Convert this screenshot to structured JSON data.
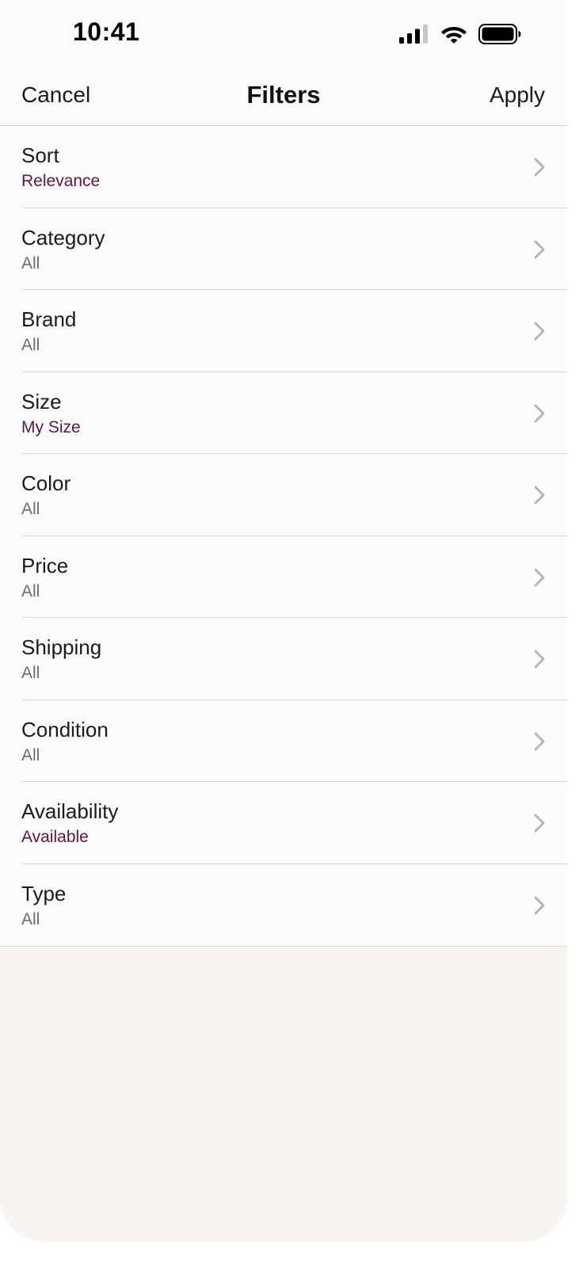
{
  "status_bar": {
    "time": "10:41",
    "icons": [
      "signal-icon",
      "wifi-icon",
      "battery-icon"
    ]
  },
  "nav": {
    "cancel_label": "Cancel",
    "title": "Filters",
    "apply_label": "Apply"
  },
  "colors": {
    "accent": "#5e1646",
    "secondary_text": "#6d6d6d",
    "primary_text": "#1b1b1b"
  },
  "filters": [
    {
      "label": "Sort",
      "value": "Relevance",
      "active": true
    },
    {
      "label": "Category",
      "value": "All",
      "active": false
    },
    {
      "label": "Brand",
      "value": "All",
      "active": false
    },
    {
      "label": "Size",
      "value": "My Size",
      "active": true
    },
    {
      "label": "Color",
      "value": "All",
      "active": false
    },
    {
      "label": "Price",
      "value": "All",
      "active": false
    },
    {
      "label": "Shipping",
      "value": "All",
      "active": false
    },
    {
      "label": "Condition",
      "value": "All",
      "active": false
    },
    {
      "label": "Availability",
      "value": "Available",
      "active": true
    },
    {
      "label": "Type",
      "value": "All",
      "active": false
    }
  ]
}
